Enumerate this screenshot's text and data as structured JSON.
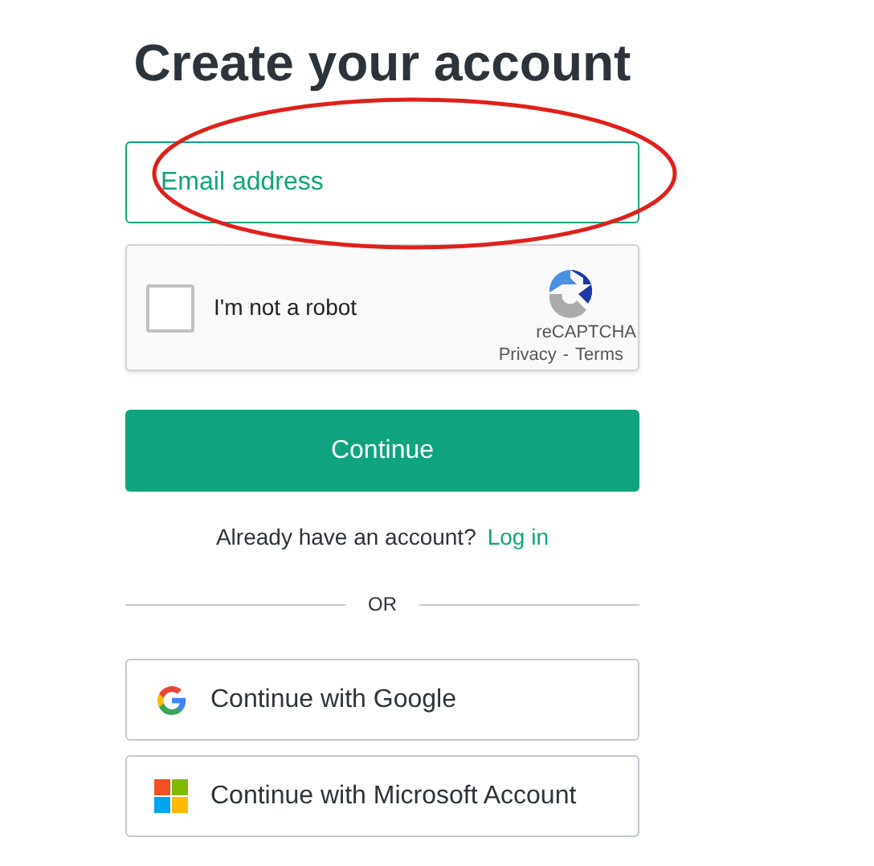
{
  "title": "Create your account",
  "email": {
    "placeholder": "Email address"
  },
  "captcha": {
    "label": "I'm not a robot",
    "checked": false,
    "brand": "reCAPTCHA",
    "privacy": "Privacy",
    "separator": "-",
    "terms": "Terms"
  },
  "continue_button": "Continue",
  "login_prompt": {
    "text": "Already have an account?",
    "link": "Log in"
  },
  "divider": "OR",
  "providers": [
    {
      "kind": "google",
      "label": "Continue with Google"
    },
    {
      "kind": "microsoft",
      "label": "Continue with Microsoft Account"
    }
  ],
  "annotation": {
    "kind": "ellipse",
    "color": "#e0201b"
  }
}
